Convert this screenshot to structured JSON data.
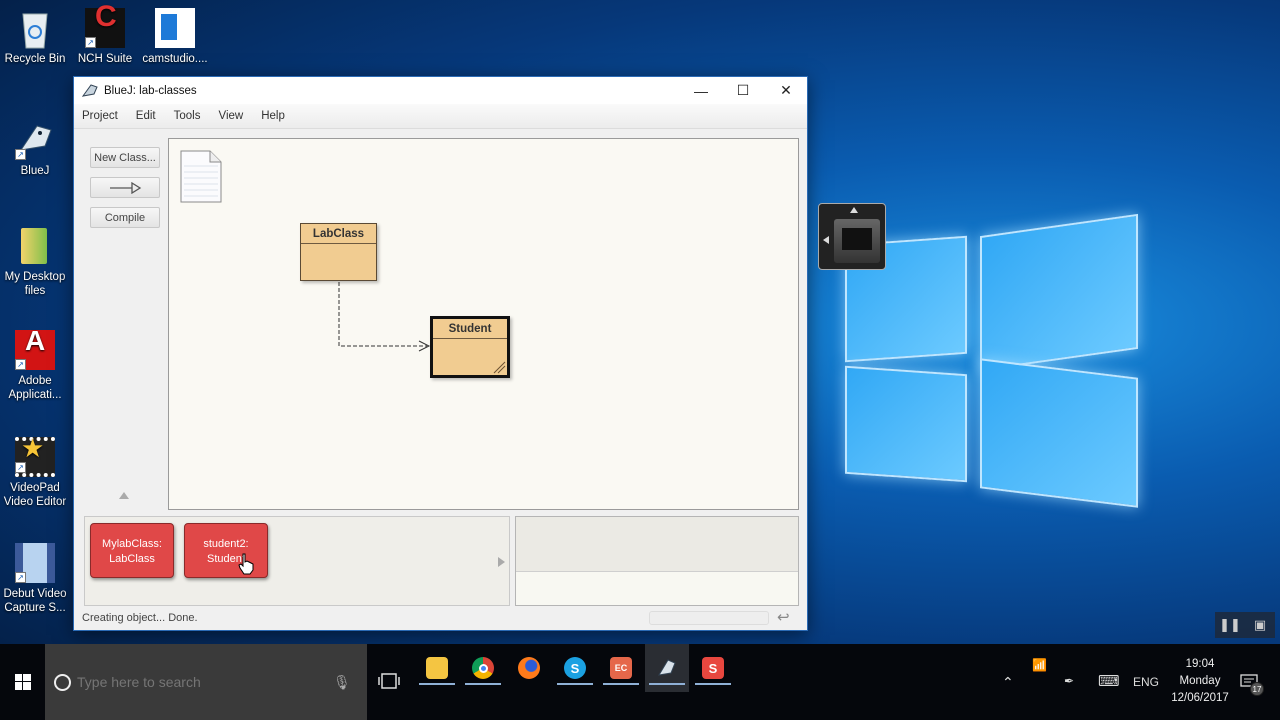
{
  "desktop": {
    "icons": [
      {
        "label": "Recycle Bin",
        "icon": "recycle-bin-icon",
        "shortcut": false
      },
      {
        "label": "NCH Suite",
        "icon": "nch-suite-icon",
        "shortcut": true
      },
      {
        "label": "camstudio....",
        "icon": "document-icon",
        "shortcut": false
      },
      {
        "label": "BlueJ",
        "icon": "bluej-icon",
        "shortcut": true
      },
      {
        "label": "My Desktop files",
        "icon": "folder-icon",
        "shortcut": false
      },
      {
        "label": "Adobe Applicati...",
        "icon": "adobe-icon",
        "shortcut": true
      },
      {
        "label": "VideoPad Video Editor",
        "icon": "videopad-icon",
        "shortcut": true
      },
      {
        "label": "Debut Video Capture S...",
        "icon": "debut-icon",
        "shortcut": true
      }
    ]
  },
  "window": {
    "title": "BlueJ:  lab-classes",
    "controls": {
      "minimize": "—",
      "maximize": "☐",
      "close": "✕"
    },
    "menu": [
      "Project",
      "Edit",
      "Tools",
      "View",
      "Help"
    ],
    "toolbar": {
      "new_class": "New Class...",
      "arrow": "⟶▷",
      "compile": "Compile"
    },
    "diagram": {
      "readme_icon": "readme-document-icon",
      "classes": [
        {
          "name": "LabClass",
          "selected": false
        },
        {
          "name": "Student",
          "selected": true
        }
      ],
      "dependencies": [
        {
          "from": "LabClass",
          "to": "Student",
          "style": "dashed"
        }
      ]
    },
    "object_bench": {
      "objects": [
        {
          "line1": "MylabClass:",
          "line2": "LabClass"
        },
        {
          "line1": "student2:",
          "line2": "Student"
        }
      ]
    },
    "status": "Creating object... Done."
  },
  "recorder": {
    "pause": "❚❚",
    "screen": "▣"
  },
  "taskbar": {
    "search_placeholder": "Type here to search",
    "apps": [
      {
        "name": "file-explorer",
        "label": "",
        "color": "#f4c542",
        "active": false
      },
      {
        "name": "chrome",
        "label": "",
        "color": "#db4437",
        "active": false
      },
      {
        "name": "firefox",
        "label": "",
        "color": "#ff7a1a",
        "active": false
      },
      {
        "name": "skype",
        "label": "S",
        "color": "#1ba1e2",
        "active": false
      },
      {
        "name": "powerpoint-recorder",
        "label": "EC",
        "color": "#e5674a",
        "active": false
      },
      {
        "name": "bluej",
        "label": "",
        "color": "#2a2d33",
        "active": true
      },
      {
        "name": "nch-app",
        "label": "S",
        "color": "#e8473f",
        "active": false
      }
    ],
    "tray": {
      "language": "ENG",
      "time": "19:04",
      "day": "Monday",
      "date": "12/06/2017",
      "notifications": "17"
    }
  }
}
